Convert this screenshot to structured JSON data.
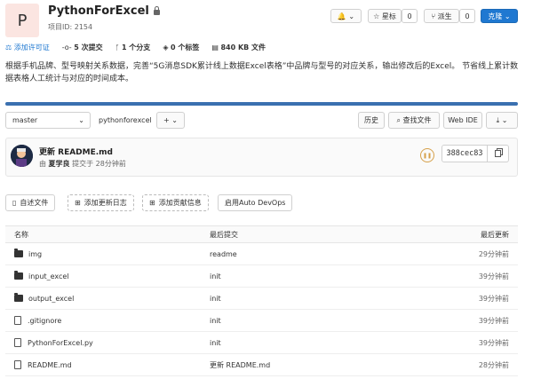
{
  "project": {
    "avatar_letter": "P",
    "name": "PythonForExcel",
    "id_label": "项目ID: 2154"
  },
  "actions": {
    "notify": "🔔",
    "star_label": "星标",
    "star_count": "0",
    "fork_label": "派生",
    "fork_count": "0",
    "clone_label": "克隆"
  },
  "stats": {
    "license": "添加许可证",
    "commits": "5 次提交",
    "branches": "1 个分支",
    "tags": "0 个标签",
    "size": "840 KB 文件"
  },
  "description": "根据手机品牌、型号映射关系数据，完善“5G消息SDK累计线上数据Excel表格”中品牌与型号的对应关系，输出修改后的Excel。 节省线上累计数据表格人工统计与对应的时间成本。",
  "repo": {
    "branch": "master",
    "breadcrumb": "pythonforexcel",
    "separator": "/",
    "plus": "+",
    "history": "历史",
    "find": "查找文件",
    "webide": "Web IDE",
    "download": "⤓"
  },
  "commit": {
    "message": "更新 README.md",
    "author_prefix": "由",
    "author": "夏学良",
    "time": "提交于 28分钟前",
    "sha": "388cec83"
  },
  "quick_actions": [
    "自述文件",
    "添加更新日志",
    "添加贡献信息",
    "启用Auto DevOps"
  ],
  "table": {
    "headers": [
      "名称",
      "最后提交",
      "最后更新"
    ],
    "rows": [
      {
        "name": "img",
        "type": "folder",
        "commit": "readme",
        "updated": "29分钟前"
      },
      {
        "name": "input_excel",
        "type": "folder",
        "commit": "init",
        "updated": "39分钟前"
      },
      {
        "name": "output_excel",
        "type": "folder",
        "commit": "init",
        "updated": "39分钟前"
      },
      {
        "name": ".gitignore",
        "type": "file",
        "commit": "init",
        "updated": "39分钟前"
      },
      {
        "name": "PythonForExcel.py",
        "type": "file",
        "commit": "init",
        "updated": "39分钟前"
      },
      {
        "name": "README.md",
        "type": "file",
        "commit": "更新 README.md",
        "updated": "28分钟前"
      }
    ]
  },
  "colors": {
    "accent": "#1f78d1",
    "progress": "#3a70b0",
    "pipeline": "#d6a04a"
  }
}
